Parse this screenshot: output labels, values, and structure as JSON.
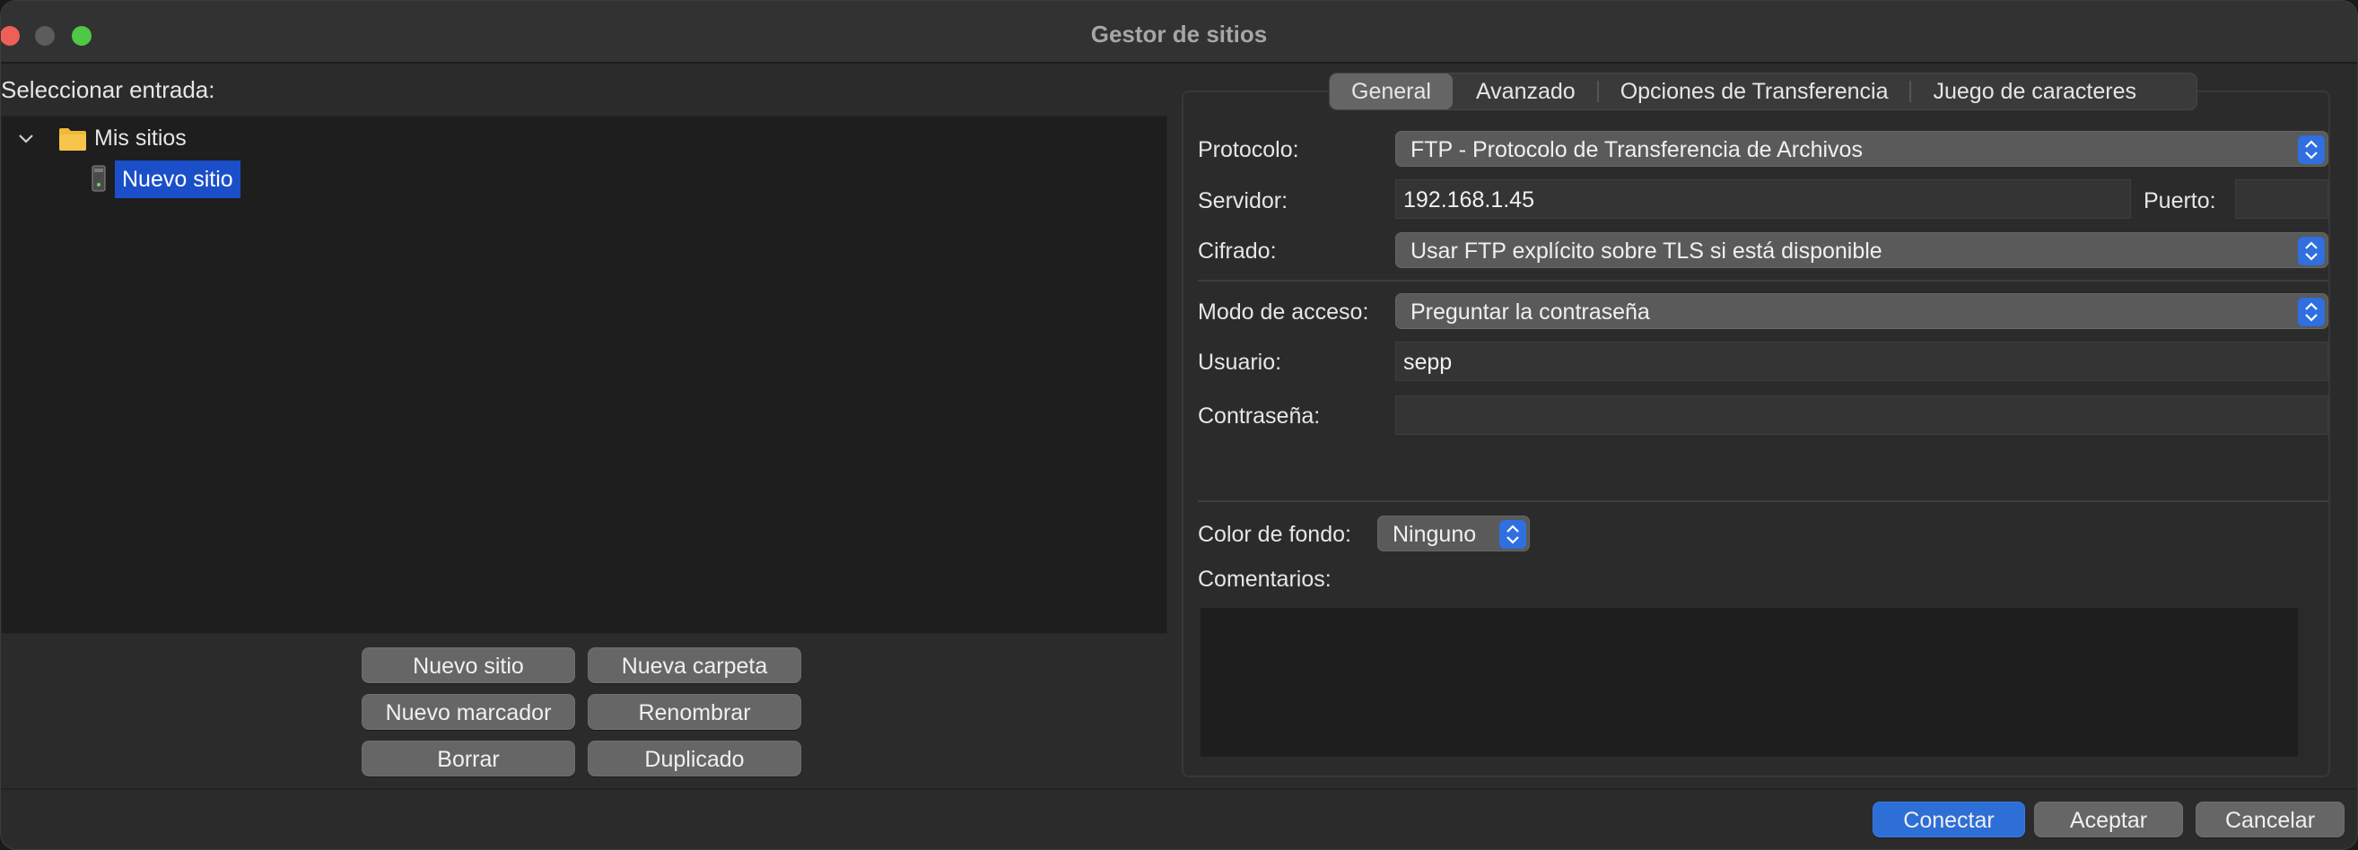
{
  "window": {
    "title": "Gestor de sitios"
  },
  "left": {
    "select_label": "Seleccionar entrada:",
    "tree": {
      "root_label": "Mis sitios",
      "child_label": "Nuevo sitio"
    },
    "buttons": {
      "new_site": "Nuevo sitio",
      "new_folder": "Nueva carpeta",
      "new_bookmark": "Nuevo marcador",
      "rename": "Renombrar",
      "delete": "Borrar",
      "duplicate": "Duplicado"
    }
  },
  "tabs": [
    "General",
    "Avanzado",
    "Opciones de Transferencia",
    "Juego de caracteres"
  ],
  "general": {
    "protocol_label": "Protocolo:",
    "protocol_value": "FTP - Protocolo de Transferencia de Archivos",
    "server_label": "Servidor:",
    "server_value": "192.168.1.45",
    "port_label": "Puerto:",
    "port_value": "",
    "encryption_label": "Cifrado:",
    "encryption_value": "Usar FTP explícito sobre TLS si está disponible",
    "access_label": "Modo de acceso:",
    "access_value": "Preguntar la contraseña",
    "user_label": "Usuario:",
    "user_value": "sepp",
    "password_label": "Contraseña:",
    "password_value": "",
    "bgcolor_label": "Color de fondo:",
    "bgcolor_value": "Ninguno",
    "comments_label": "Comentarios:",
    "comments_value": ""
  },
  "footer": {
    "connect": "Conectar",
    "accept": "Aceptar",
    "cancel": "Cancelar"
  },
  "colors": {
    "accent": "#2d6fd6",
    "selection": "#1a4fc9",
    "close": "#ee5f57",
    "maximize": "#4ec846"
  }
}
